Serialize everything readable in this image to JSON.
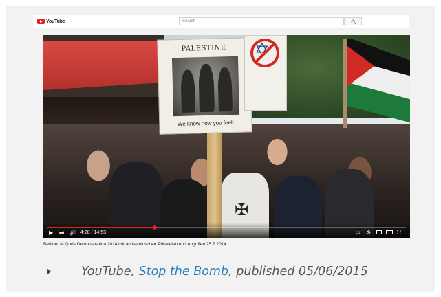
{
  "youtube": {
    "logo_text": "YouTube",
    "search_placeholder": "Search",
    "search_icon": "magnifier-icon",
    "brand_color": "#e62117"
  },
  "video": {
    "sign_title": "PALESTINE",
    "sign_caption": "We know how you feel!",
    "time_display": "4:28 / 14:53",
    "progress": 0.3,
    "title": "Berliner Al Quds Demonstration 2014 mit antisemitischen Pöbeleien und Angriffen 25 7 2014"
  },
  "caption": {
    "prefix": "YouTube, ",
    "link_text": "Stop the Bomb",
    "suffix": ", published 05/06/2015",
    "link_color": "#2a7fbf"
  }
}
